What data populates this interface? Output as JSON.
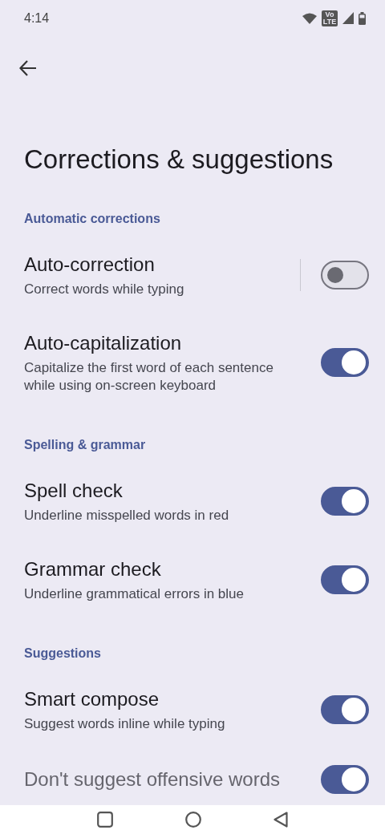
{
  "status_bar": {
    "time": "4:14",
    "network_badge": "Vo LTE"
  },
  "title": "Corrections & suggestions",
  "sections": [
    {
      "header": "Automatic corrections",
      "items": [
        {
          "kind": "switch",
          "title": "Auto-correction",
          "subtitle": "Correct words while typing",
          "on": false,
          "separator": true
        },
        {
          "kind": "switch",
          "title": "Auto-capitalization",
          "subtitle": "Capitalize the first word of each sentence while using on-screen keyboard",
          "on": true,
          "separator": false
        }
      ]
    },
    {
      "header": "Spelling & grammar",
      "items": [
        {
          "kind": "switch",
          "title": "Spell check",
          "subtitle": "Underline misspelled words in red",
          "on": true,
          "separator": false
        },
        {
          "kind": "switch",
          "title": "Grammar check",
          "subtitle": "Underline grammatical errors in blue",
          "on": true,
          "separator": false
        }
      ]
    },
    {
      "header": "Suggestions",
      "items": [
        {
          "kind": "switch",
          "title": "Smart compose",
          "subtitle": "Suggest words inline while typing",
          "on": true,
          "separator": false
        },
        {
          "kind": "switch",
          "title": "Don't suggest offensive words",
          "on": true,
          "separator": false
        }
      ]
    }
  ]
}
